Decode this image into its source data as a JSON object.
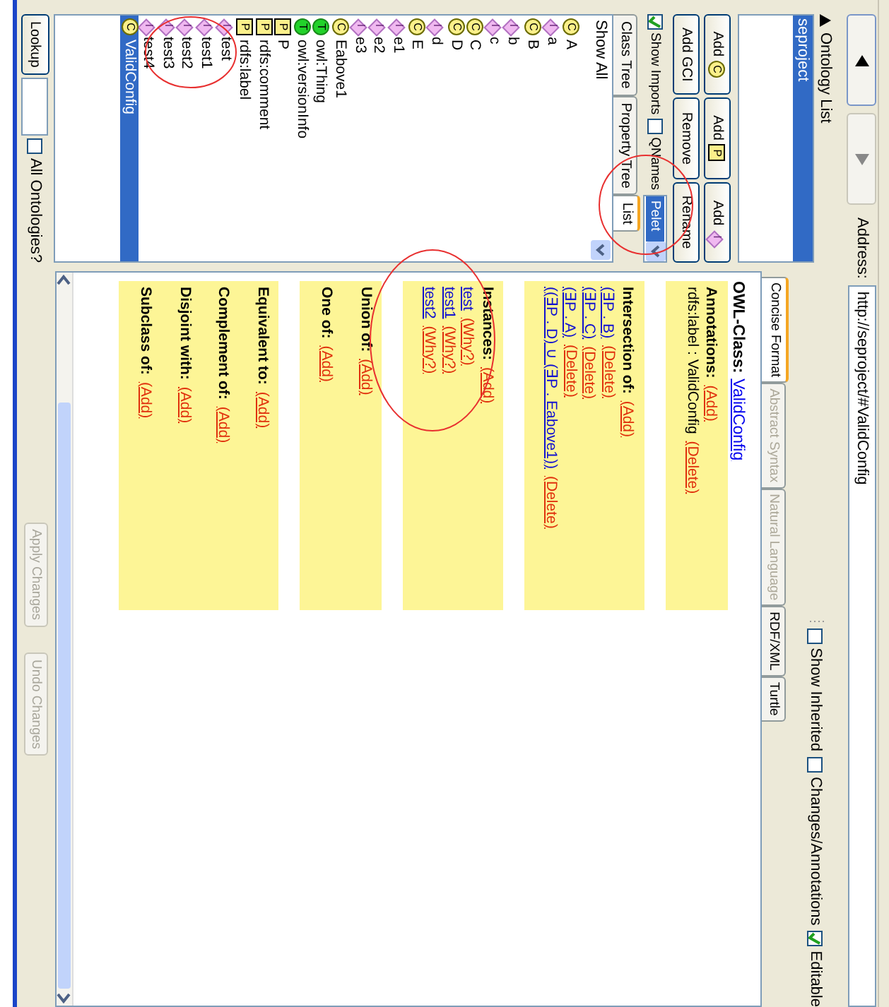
{
  "toolbar": {
    "address_label": "Address:",
    "address": "http://seproject/#ValidConfig"
  },
  "ontology_list": {
    "title": "Ontology List",
    "items": [
      {
        "label": "seproject",
        "selected": true
      }
    ]
  },
  "entity_buttons": [
    {
      "label": "Add",
      "badge": "C",
      "kind": "class"
    },
    {
      "label": "Add",
      "badge": "P",
      "kind": "property"
    },
    {
      "label": "Add",
      "badge": "I",
      "kind": "individual"
    },
    {
      "label": "Add GCI",
      "kind": "plain"
    },
    {
      "label": "Remove",
      "kind": "plain"
    },
    {
      "label": "Rename",
      "kind": "plain"
    }
  ],
  "options": [
    {
      "label": "Show Imports",
      "checked": true
    },
    {
      "label": "QNames",
      "checked": false
    }
  ],
  "reasoner": {
    "value": "Pelet",
    "selected": true
  },
  "tree_tabs": [
    {
      "label": "Class Tree",
      "selected": false
    },
    {
      "label": "Property Tree",
      "selected": false
    },
    {
      "label": "List",
      "selected": true
    }
  ],
  "filter": {
    "value": "Show All"
  },
  "entities": [
    {
      "name": "A",
      "kind": "class",
      "badge": "C",
      "selected": false
    },
    {
      "name": "a",
      "kind": "individual",
      "badge": "I",
      "selected": false
    },
    {
      "name": "B",
      "kind": "class",
      "badge": "C",
      "selected": false
    },
    {
      "name": "b",
      "kind": "individual",
      "badge": "I",
      "selected": false
    },
    {
      "name": "c",
      "kind": "individual",
      "badge": "I",
      "selected": false
    },
    {
      "name": "C",
      "kind": "class",
      "badge": "C",
      "selected": false
    },
    {
      "name": "D",
      "kind": "class",
      "badge": "C",
      "selected": false
    },
    {
      "name": "d",
      "kind": "individual",
      "badge": "I",
      "selected": false
    },
    {
      "name": "E",
      "kind": "class",
      "badge": "C",
      "selected": false
    },
    {
      "name": "e1",
      "kind": "individual",
      "badge": "I",
      "selected": false
    },
    {
      "name": "e2",
      "kind": "individual",
      "badge": "I",
      "selected": false
    },
    {
      "name": "e3",
      "kind": "individual",
      "badge": "I",
      "selected": false
    },
    {
      "name": "Eabove1",
      "kind": "class",
      "badge": "C",
      "selected": false
    },
    {
      "name": "owl:Thing",
      "kind": "thing",
      "badge": "T",
      "selected": false
    },
    {
      "name": "owl:versionInfo",
      "kind": "thing",
      "badge": "T",
      "selected": false
    },
    {
      "name": "P",
      "kind": "property",
      "badge": "P",
      "selected": false
    },
    {
      "name": "rdfs:comment",
      "kind": "property",
      "badge": "P",
      "selected": false
    },
    {
      "name": "rdfs:label",
      "kind": "property",
      "badge": "P",
      "selected": false
    },
    {
      "name": "test",
      "kind": "individual",
      "badge": "I",
      "selected": false
    },
    {
      "name": "test1",
      "kind": "individual",
      "badge": "I",
      "selected": false
    },
    {
      "name": "test2",
      "kind": "individual",
      "badge": "I",
      "selected": false
    },
    {
      "name": "test3",
      "kind": "individual",
      "badge": "I",
      "selected": false
    },
    {
      "name": "test4",
      "kind": "individual",
      "badge": "I",
      "selected": false
    },
    {
      "name": "ValidConfig",
      "kind": "class",
      "badge": "C",
      "selected": true
    }
  ],
  "lookup": {
    "button": "Lookup",
    "all_ontologies": {
      "label": "All Ontologies?",
      "checked": false
    }
  },
  "view_options": [
    {
      "label": "Show Inherited",
      "checked": false
    },
    {
      "label": "Changes/Annotations",
      "checked": false
    },
    {
      "label": "Editable",
      "checked": true
    }
  ],
  "format_tabs": [
    {
      "label": "Concise Format",
      "selected": true,
      "disabled": false
    },
    {
      "label": "Abstract Syntax",
      "selected": false,
      "disabled": true
    },
    {
      "label": "Natural Language",
      "selected": false,
      "disabled": true
    },
    {
      "label": "RDF/XML",
      "selected": false,
      "disabled": false
    },
    {
      "label": "Turtle",
      "selected": false,
      "disabled": false
    }
  ],
  "heading": {
    "label": "OWL-Class:",
    "entity": "ValidConfig"
  },
  "panels": [
    {
      "sections": [
        {
          "title": "Annotations:",
          "action": "(Add)",
          "lines": [
            {
              "kind": "text",
              "text": "rdfs:label : ValidConfig",
              "action": "(Delete)"
            }
          ]
        }
      ]
    },
    {
      "sections": [
        {
          "title": "Intersection of:",
          "action": "(Add)",
          "lines": [
            {
              "kind": "expression",
              "text": "(∃P . B)",
              "action": "(Delete)"
            },
            {
              "kind": "expression",
              "text": "(∃P . C)",
              "action": "(Delete)"
            },
            {
              "kind": "expression",
              "text": "(∃P . A)",
              "action": "(Delete)"
            },
            {
              "kind": "expression",
              "text": "((∃P . D) ∪ (∃P . Eabove1))",
              "action": "(Delete)"
            }
          ]
        }
      ]
    },
    {
      "sections": [
        {
          "title": "Instances:",
          "action": "(Add)",
          "lines": [
            {
              "kind": "link",
              "text": "test",
              "action": "(Why?)"
            },
            {
              "kind": "link",
              "text": "test1",
              "action": "(Why?)"
            },
            {
              "kind": "link",
              "text": "test2",
              "action": "(Why?)"
            }
          ]
        }
      ]
    },
    {
      "sections": [
        {
          "title": "Union of:",
          "action": "(Add)"
        },
        {
          "title": "One of:",
          "action": "(Add)"
        }
      ]
    },
    {
      "sections": [
        {
          "title": "Equivalent to:",
          "action": "(Add)"
        },
        {
          "title": "Complement of:",
          "action": "(Add)"
        },
        {
          "title": "Disjoint with:",
          "action": "(Add)"
        },
        {
          "title": "Subclass of:",
          "action": "(Add)"
        }
      ]
    }
  ],
  "bottom_buttons": [
    {
      "label": "Apply Changes",
      "disabled": true
    },
    {
      "label": "Undo Changes",
      "disabled": true
    }
  ]
}
